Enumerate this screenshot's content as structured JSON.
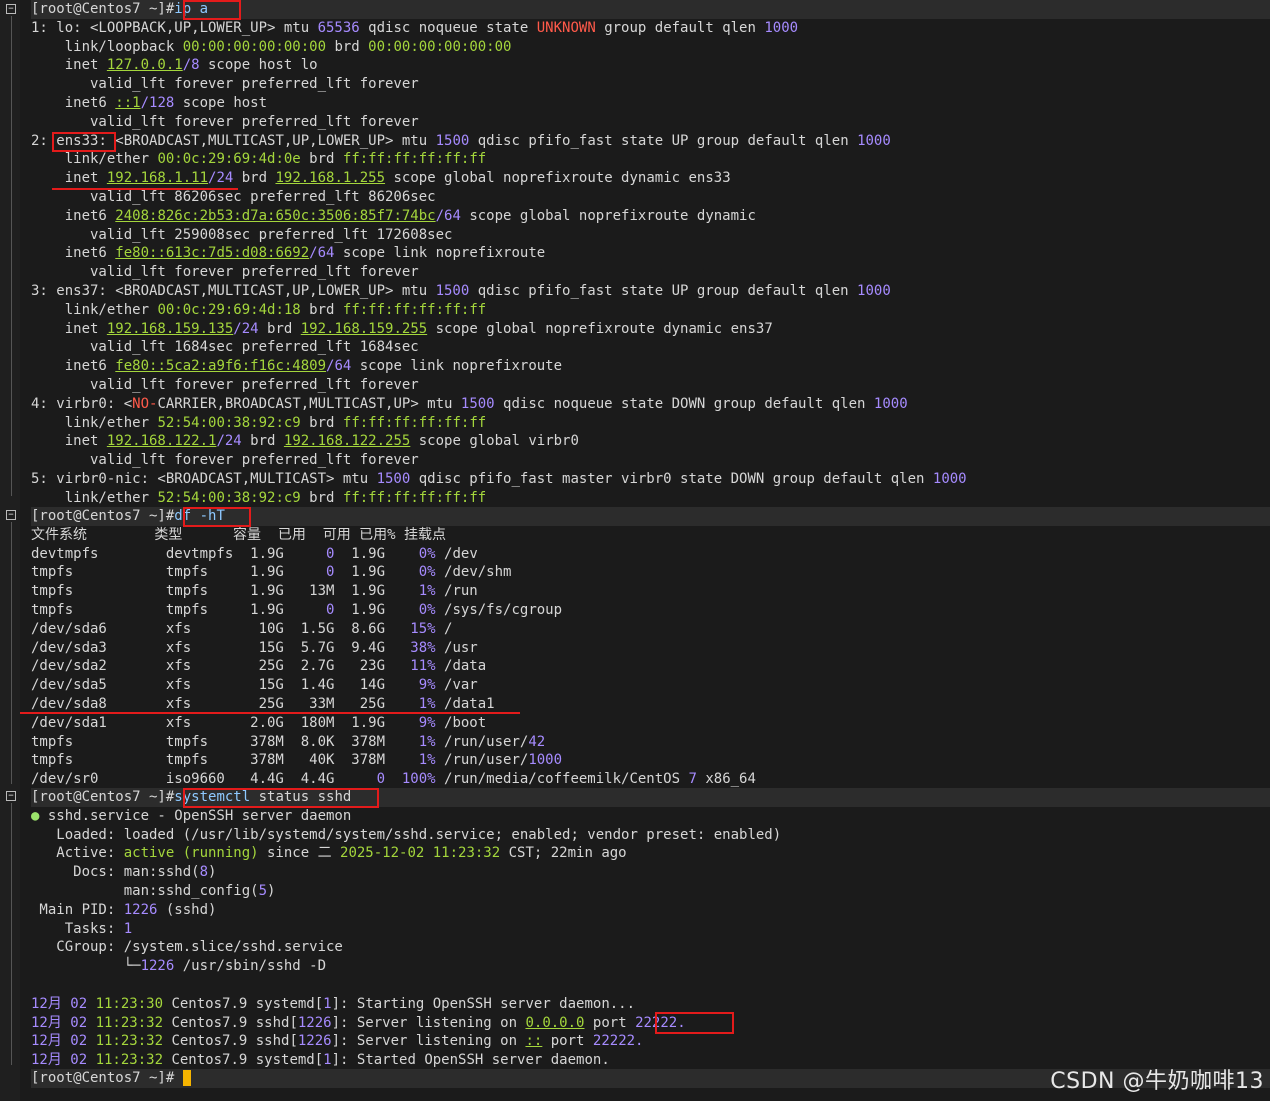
{
  "terminal": {
    "prompt": "[root@Centos7 ~]#",
    "commands": {
      "ip": "ip a",
      "df": "df -hT",
      "systemctl_a": "systemctl",
      "systemctl_b": " status sshd"
    },
    "ip_lines": {
      "l1a": "1: lo: <LOOPBACK,UP,LOWER_UP> mtu ",
      "l1b": "65536",
      "l1c": " qdisc noqueue state ",
      "l1d": "UNKNOWN",
      "l1e": " group default qlen ",
      "l1f": "1000",
      "l2a": "    link/loopback ",
      "l2b": "00:00:00:00:00:00",
      "l2c": " brd ",
      "l2d": "00:00:00:00:00:00",
      "l3a": "    inet ",
      "l3b": "127.0.0.1",
      "l3c": "/8",
      "l3d": " scope host lo",
      "l4": "       valid_lft forever preferred_lft forever",
      "l5a": "    inet6 ",
      "l5b": "::1",
      "l5c": "/128",
      "l5d": " scope host",
      "l6": "       valid_lft forever preferred_lft forever",
      "l7a": "2: ",
      "l7b": "ens33:",
      "l7c": " <BROADCAST,MULTICAST,UP,LOWER_UP> mtu ",
      "l7d": "1500",
      "l7e": " qdisc pfifo_fast state UP group default qlen ",
      "l7f": "1000",
      "l8a": "    link/ether ",
      "l8b": "00:0c:29:69:4d:0e",
      "l8c": " brd ",
      "l8d": "ff:ff:ff:ff:ff:ff",
      "l9a": "    inet ",
      "l9b": "192.168.1.11",
      "l9c": "/24",
      "l9d": " brd ",
      "l9e": "192.168.1.255",
      "l9f": " scope global noprefixroute dynamic ens33",
      "l10": "       valid_lft 86206sec preferred_lft 86206sec",
      "l11a": "    inet6 ",
      "l11b": "2408:826c:2b53:d7a:650c:3506:85f7:74bc",
      "l11c": "/64",
      "l11d": " scope global noprefixroute dynamic",
      "l12": "       valid_lft 259008sec preferred_lft 172608sec",
      "l13a": "    inet6 ",
      "l13b": "fe80::613c:7d5:d08:6692",
      "l13c": "/64",
      "l13d": " scope link noprefixroute",
      "l14": "       valid_lft forever preferred_lft forever",
      "l15a": "3: ens37: <BROADCAST,MULTICAST,UP,LOWER_UP> mtu ",
      "l15b": "1500",
      "l15c": " qdisc pfifo_fast state UP group default qlen ",
      "l15d": "1000",
      "l16a": "    link/ether ",
      "l16b": "00:0c:29:69:4d:18",
      "l16c": " brd ",
      "l16d": "ff:ff:ff:ff:ff:ff",
      "l17a": "    inet ",
      "l17b": "192.168.159.135",
      "l17c": "/24",
      "l17d": " brd ",
      "l17e": "192.168.159.255",
      "l17f": " scope global noprefixroute dynamic ens37",
      "l18": "       valid_lft 1684sec preferred_lft 1684sec",
      "l19a": "    inet6 ",
      "l19b": "fe80::5ca2:a9f6:f16c:4809",
      "l19c": "/64",
      "l19d": " scope link noprefixroute",
      "l20": "       valid_lft forever preferred_lft forever",
      "l21a": "4: virbr0: <",
      "l21b": "NO-",
      "l21c": "CARRIER,BROADCAST,MULTICAST,UP> mtu ",
      "l21d": "1500",
      "l21e": " qdisc noqueue state DOWN group default qlen ",
      "l21f": "1000",
      "l22a": "    link/ether ",
      "l22b": "52:54:00:38:92:c9",
      "l22c": " brd ",
      "l22d": "ff:ff:ff:ff:ff:ff",
      "l23a": "    inet ",
      "l23b": "192.168.122.1",
      "l23c": "/24",
      "l23d": " brd ",
      "l23e": "192.168.122.255",
      "l23f": " scope global virbr0",
      "l24": "       valid_lft forever preferred_lft forever",
      "l25a": "5: virbr0-nic: <BROADCAST,MULTICAST> mtu ",
      "l25b": "1500",
      "l25c": " qdisc pfifo_fast master virbr0 state DOWN group default qlen ",
      "l25d": "1000",
      "l26a": "    link/ether ",
      "l26b": "52:54:00:38:92:c9",
      "l26c": " brd ",
      "l26d": "ff:ff:ff:ff:ff:ff"
    },
    "df": {
      "header": "文件系统        类型      容量  已用  可用 已用% 挂载点",
      "rows": [
        {
          "a": "devtmpfs        devtmpfs  1.9G     ",
          "b": "0",
          "c": "  1.9G    ",
          "d": "0%",
          "e": " /dev"
        },
        {
          "a": "tmpfs           tmpfs     1.9G     ",
          "b": "0",
          "c": "  1.9G    ",
          "d": "0%",
          "e": " /dev/shm"
        },
        {
          "a": "tmpfs           tmpfs     1.9G   13M  1.9G    ",
          "b": "",
          "c": "",
          "d": "1%",
          "e": " /run"
        },
        {
          "a": "tmpfs           tmpfs     1.9G     ",
          "b": "0",
          "c": "  1.9G    ",
          "d": "0%",
          "e": " /sys/fs/cgroup"
        },
        {
          "a": "/dev/sda6       xfs        10G  1.5G  8.6G   ",
          "b": "",
          "c": "",
          "d": "15%",
          "e": " /"
        },
        {
          "a": "/dev/sda3       xfs        15G  5.7G  9.4G   ",
          "b": "",
          "c": "",
          "d": "38%",
          "e": " /usr"
        },
        {
          "a": "/dev/sda2       xfs        25G  2.7G   23G   ",
          "b": "",
          "c": "",
          "d": "11%",
          "e": " /data"
        },
        {
          "a": "/dev/sda5       xfs        15G  1.4G   14G    ",
          "b": "",
          "c": "",
          "d": "9%",
          "e": " /var"
        },
        {
          "a": "/dev/sda8       xfs        25G   33M   25G    ",
          "b": "",
          "c": "",
          "d": "1%",
          "e": " /data1"
        },
        {
          "a": "/dev/sda1       xfs       2.0G  180M  1.9G    ",
          "b": "",
          "c": "",
          "d": "9%",
          "e": " /boot"
        },
        {
          "a": "tmpfs           tmpfs     378M  8.0K  378M    ",
          "b": "",
          "c": "",
          "d": "1%",
          "e": " /run/user/",
          "f": "42"
        },
        {
          "a": "tmpfs           tmpfs     378M   40K  378M    ",
          "b": "",
          "c": "",
          "d": "1%",
          "e": " /run/user/",
          "f": "1000"
        },
        {
          "a": "/dev/sr0        iso9660   4.4G  4.4G     ",
          "b": "0",
          "c": "  ",
          "d": "100%",
          "e": " /run/media/coffeemilk/CentOS ",
          "f": "7",
          "g": " x86_64"
        }
      ]
    },
    "status": {
      "s1a": "● ",
      "s1b": "sshd.service - OpenSSH server daemon",
      "s2a": "   Loaded: loaded (/usr/lib/systemd/system/sshd.service; enabled; vendor preset: enabled)",
      "s3a": "   Active: ",
      "s3b": "active (running)",
      "s3c": " since 二 ",
      "s3d": "2025-12-02 11:23:32",
      "s3e": " CST; 22min ago",
      "s4a": "     Docs: man:sshd(",
      "s4b": "8",
      "s4c": ")",
      "s5a": "           man:sshd_config(",
      "s5b": "5",
      "s5c": ")",
      "s6a": " Main PID: ",
      "s6b": "1226",
      "s6c": " (sshd)",
      "s7a": "    Tasks: ",
      "s7b": "1",
      "s8": "   CGroup: /system.slice/sshd.service",
      "s9a": "           └─",
      "s9b": "1226",
      "s9c": " /usr/sbin/sshd -D"
    },
    "logs": [
      {
        "m": "12月",
        "d": " 02 ",
        "t": "11:23:30",
        "rest": " Centos7.9 systemd[",
        "pid": "1",
        "msg": "]: Starting OpenSSH server daemon..."
      },
      {
        "m": "12月",
        "d": " 02 ",
        "t": "11:23:32",
        "rest": " Centos7.9 sshd[",
        "pid": "1226",
        "msg": "]: Server listening on ",
        "ip": "0.0.0.0",
        "port_label": " port ",
        "port": "22222."
      },
      {
        "m": "12月",
        "d": " 02 ",
        "t": "11:23:32",
        "rest": " Centos7.9 sshd[",
        "pid": "1226",
        "msg": "]: Server listening on ",
        "ip": "::",
        "port_label": " port ",
        "port": "22222."
      },
      {
        "m": "12月",
        "d": " 02 ",
        "t": "11:23:32",
        "rest": " Centos7.9 systemd[",
        "pid": "1",
        "msg": "]: Started OpenSSH server daemon."
      }
    ]
  },
  "watermark": "CSDN @牛奶咖啡13",
  "colors": {
    "background": "#1b1b1b",
    "text": "#d6d6d6",
    "green": "#a4d63c",
    "purple": "#a68bff",
    "red": "#ff5a4a",
    "annotation": "#e31b1b"
  }
}
